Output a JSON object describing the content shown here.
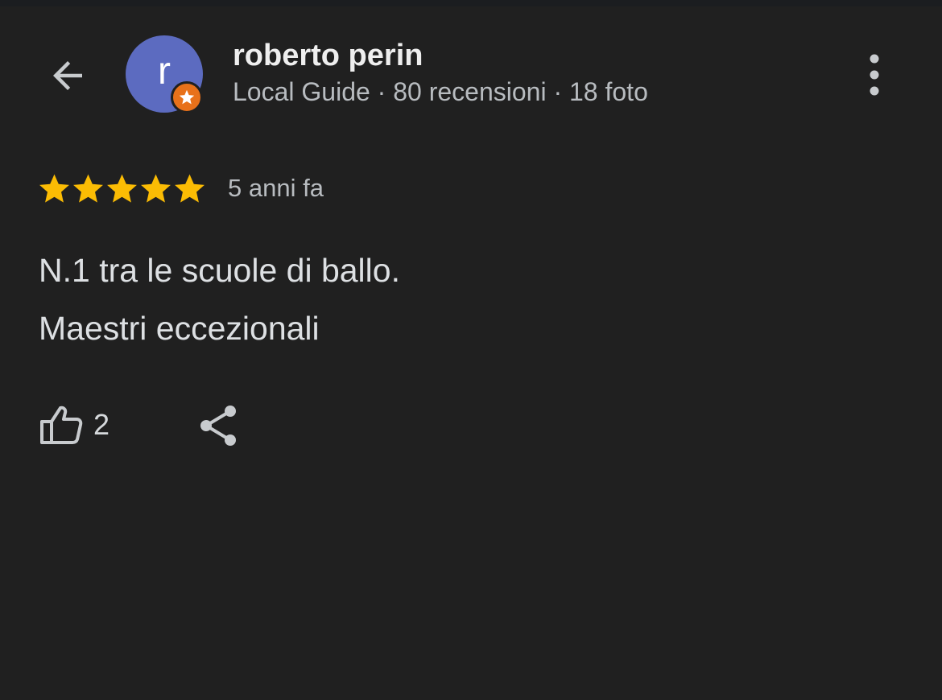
{
  "header": {
    "back_icon": "arrow-back-icon",
    "more_icon": "more-vert-icon"
  },
  "reviewer": {
    "avatar_letter": "r",
    "avatar_color": "#5c6bc0",
    "badge_icon": "local-guide-star-icon",
    "badge_color": "#e8711a",
    "name": "roberto perin",
    "meta": "Local Guide · 80 recensioni · 18 foto"
  },
  "review": {
    "rating": 5,
    "rating_max": 5,
    "star_color": "#fbbc04",
    "star_icon": "star-icon",
    "age": "5 anni fa",
    "lines": [
      "N.1 tra le scuole di ballo.",
      "Maestri eccezionali"
    ]
  },
  "actions": {
    "like_icon": "thumb-up-icon",
    "like_count": "2",
    "share_icon": "share-icon"
  }
}
